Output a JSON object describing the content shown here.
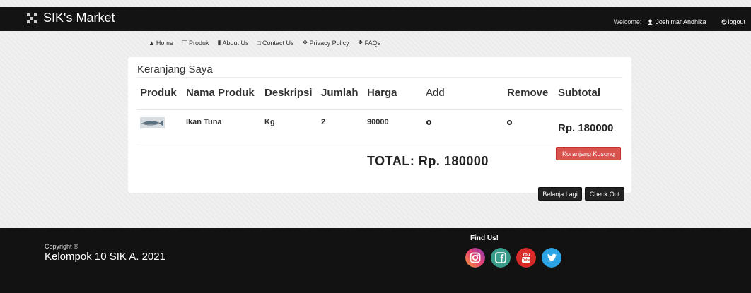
{
  "brand": {
    "name": "SIK's Market",
    "icon": "grid-logo-icon"
  },
  "account": {
    "welcome": "Welcome:",
    "user": "Joshimar Andhika",
    "logout": "logout"
  },
  "nav": [
    {
      "label": "Home",
      "icon": "home-icon"
    },
    {
      "label": "Produk",
      "icon": "list-icon"
    },
    {
      "label": "About Us",
      "icon": "bookmark-icon"
    },
    {
      "label": "Contact Us",
      "icon": "contact-icon"
    },
    {
      "label": "Privacy Policy",
      "icon": "info-icon"
    },
    {
      "label": "FAQs",
      "icon": "question-icon"
    }
  ],
  "cart": {
    "title": "Keranjang Saya",
    "columns": [
      "Produk",
      "Nama Produk",
      "Deskripsi",
      "Jumlah",
      "Harga",
      "Add",
      "Remove",
      "Subtotal"
    ],
    "rows": [
      {
        "image": "tuna-fish-thumbnail",
        "name": "Ikan Tuna",
        "desc": "Kg",
        "qty": "2",
        "price": "90000",
        "subtotal": "Rp. 180000"
      }
    ],
    "total": "TOTAL: Rp. 180000",
    "empty_button": "Koranjang Kosong",
    "continue_button": "Belanja Lagi",
    "checkout_button": "Check Out"
  },
  "footer": {
    "copyright_line1": "Copyright ©",
    "copyright_line2": "Kelompok 10 SIK A. 2021",
    "find_us": "Find Us!",
    "social": [
      "instagram-icon",
      "facebook-icon",
      "youtube-icon",
      "twitter-icon"
    ]
  },
  "colors": {
    "navbar": "#131313",
    "danger": "#d9534f",
    "footer": "#121212"
  }
}
